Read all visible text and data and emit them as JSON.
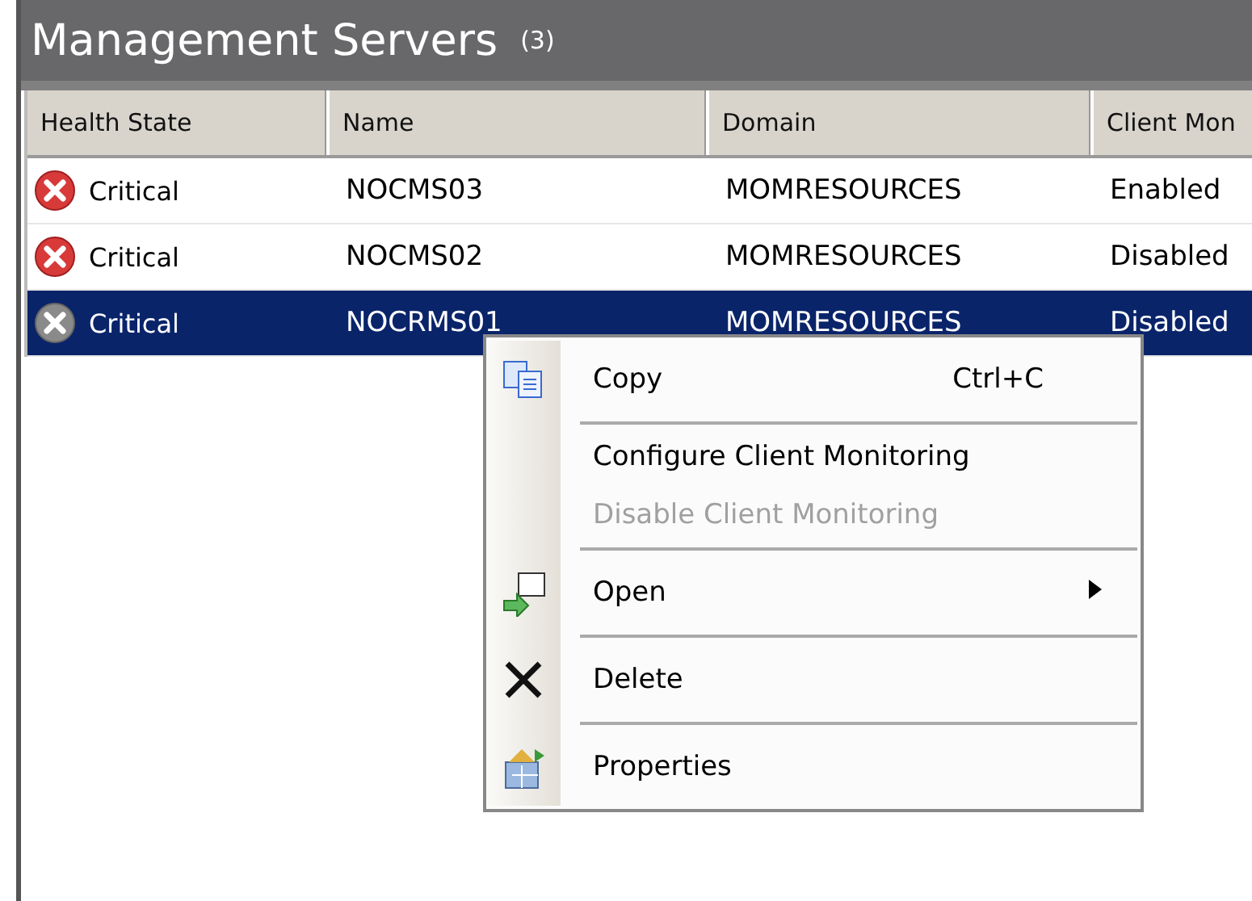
{
  "panel": {
    "title": "Management Servers",
    "count": "(3)"
  },
  "table": {
    "columns": [
      "Health State",
      "Name",
      "Domain",
      "Client Mon"
    ],
    "rows": [
      {
        "health": "Critical",
        "name": "NOCMS03",
        "domain": "MOMRESOURCES",
        "column_4": "Enabled",
        "selected": false
      },
      {
        "health": "Critical",
        "name": "NOCMS02",
        "domain": "MOMRESOURCES",
        "column_4": "Disabled",
        "selected": false
      },
      {
        "health": "Critical",
        "name": "NOCRMS01",
        "domain": "MOMRESOURCES",
        "column_4": "Disabled",
        "selected": true
      }
    ]
  },
  "context_menu": {
    "items": [
      {
        "kind": "copy",
        "label": "Copy",
        "shortcut": "Ctrl+C",
        "disabled": false
      },
      {
        "kind": "separator"
      },
      {
        "kind": "item",
        "label": "Configure Client Monitoring",
        "disabled": false
      },
      {
        "kind": "item",
        "label": "Disable Client Monitoring",
        "disabled": true
      },
      {
        "kind": "separator"
      },
      {
        "kind": "open",
        "label": "Open",
        "submenu": true,
        "disabled": false
      },
      {
        "kind": "separator"
      },
      {
        "kind": "delete",
        "label": "Delete",
        "disabled": false
      },
      {
        "kind": "separator"
      },
      {
        "kind": "properties",
        "label": "Properties",
        "disabled": false
      }
    ]
  }
}
